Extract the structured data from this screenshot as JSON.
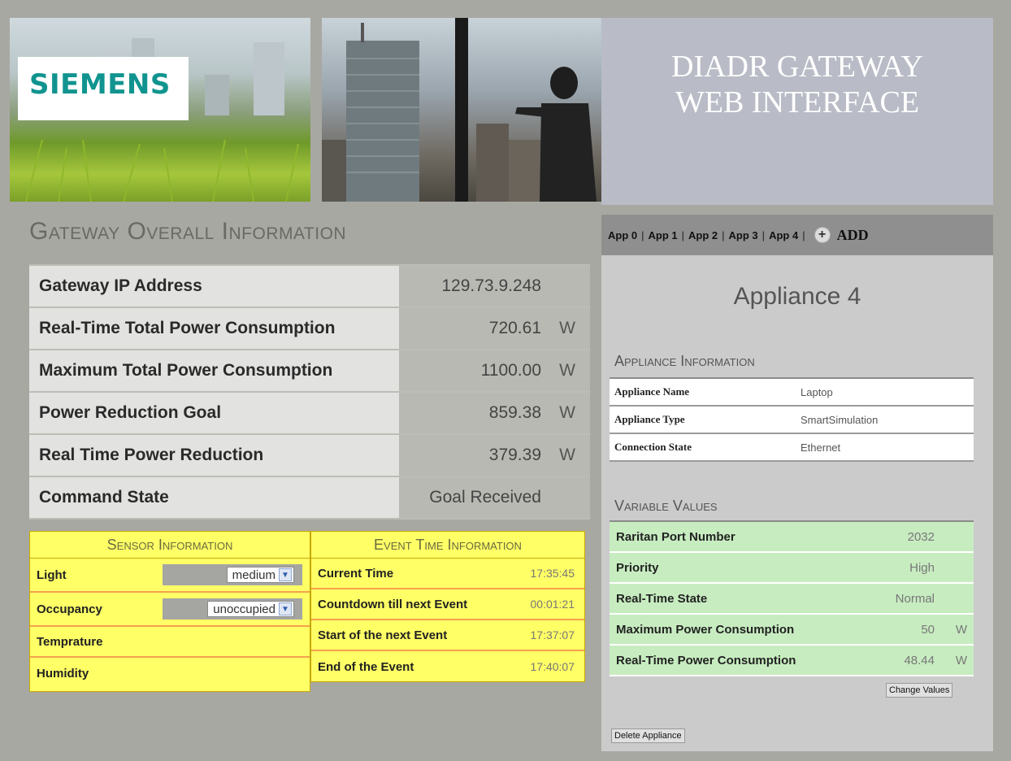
{
  "header": {
    "logo_text": "SIEMENS",
    "title_line1": "DIADR GATEWAY",
    "title_line2": "WEB INTERFACE"
  },
  "overview": {
    "title": "Gateway Overall Information",
    "rows": [
      {
        "label": "Gateway IP Address",
        "value": "129.73.9.248",
        "unit": ""
      },
      {
        "label": "Real-Time Total Power Consumption",
        "value": "720.61",
        "unit": "W"
      },
      {
        "label": "Maximum Total Power Consumption",
        "value": "1100.00",
        "unit": "W"
      },
      {
        "label": "Power Reduction Goal",
        "value": "859.38",
        "unit": "W"
      },
      {
        "label": "Real Time Power Reduction",
        "value": "379.39",
        "unit": "W"
      },
      {
        "label": "Command State",
        "value": "Goal Received",
        "unit": ""
      }
    ]
  },
  "sensor": {
    "title": "Sensor Information",
    "rows": [
      {
        "label": "Light",
        "selected": "medium"
      },
      {
        "label": "Occupancy",
        "selected": "unoccupied"
      },
      {
        "label": "Temprature"
      },
      {
        "label": "Humidity"
      }
    ]
  },
  "event": {
    "title": "Event Time Information",
    "rows": [
      {
        "label": "Current Time",
        "value": "17:35:45"
      },
      {
        "label": "Countdown till next Event",
        "value": "00:01:21"
      },
      {
        "label": "Start of the next Event",
        "value": "17:37:07"
      },
      {
        "label": "End of the Event",
        "value": "17:40:07"
      }
    ]
  },
  "tabs": {
    "items": [
      "App 0",
      "App 1",
      "App 2",
      "App 3",
      "App 4"
    ],
    "add_label": "ADD"
  },
  "appliance": {
    "title": "Appliance 4",
    "info_title": "Appliance Information",
    "info": [
      {
        "label": "Appliance Name",
        "value": "Laptop"
      },
      {
        "label": "Appliance Type",
        "value": "SmartSimulation"
      },
      {
        "label": "Connection State",
        "value": "Ethernet"
      }
    ],
    "vars_title": "Variable Values",
    "vars": [
      {
        "label": "Raritan Port Number",
        "value": "2032",
        "unit": ""
      },
      {
        "label": "Priority",
        "value": "High",
        "unit": ""
      },
      {
        "label": "Real-Time State",
        "value": "Normal",
        "unit": ""
      },
      {
        "label": "Maximum Power Consumption",
        "value": "50",
        "unit": "W"
      },
      {
        "label": "Real-Time Power Consumption",
        "value": "48.44",
        "unit": "W"
      }
    ],
    "change_button": "Change Values",
    "delete_button": "Delete Appliance"
  },
  "colors": {
    "page_bg": "#a8a8a2",
    "sensor_panel": "#ffff66",
    "variable_rows": "#c7ecc0",
    "siemens_teal": "#11948f"
  }
}
